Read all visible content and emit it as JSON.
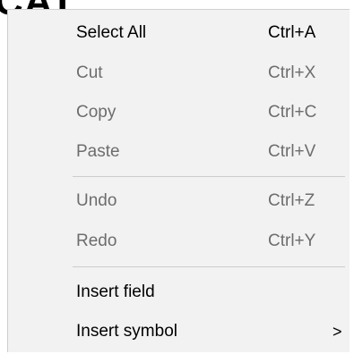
{
  "background": {
    "text": "CAT"
  },
  "menu": {
    "items": [
      {
        "label": "Select All",
        "shortcut": "Ctrl+A",
        "enabled": true
      },
      {
        "label": "Cut",
        "shortcut": "Ctrl+X",
        "enabled": false
      },
      {
        "label": "Copy",
        "shortcut": "Ctrl+C",
        "enabled": false
      },
      {
        "label": "Paste",
        "shortcut": "Ctrl+V",
        "enabled": false
      },
      {
        "label": "Undo",
        "shortcut": "Ctrl+Z",
        "enabled": false
      },
      {
        "label": "Redo",
        "shortcut": "Ctrl+Y",
        "enabled": false
      },
      {
        "label": "Insert field",
        "shortcut": "",
        "enabled": true
      },
      {
        "label": "Insert symbol",
        "shortcut": "",
        "enabled": true,
        "submenu_arrow": ">"
      }
    ]
  },
  "colors": {
    "menu_background": "#f2f2f2",
    "enabled_text": "#000000",
    "disabled_text": "#6d6d6d",
    "separator": "#cccccc"
  }
}
